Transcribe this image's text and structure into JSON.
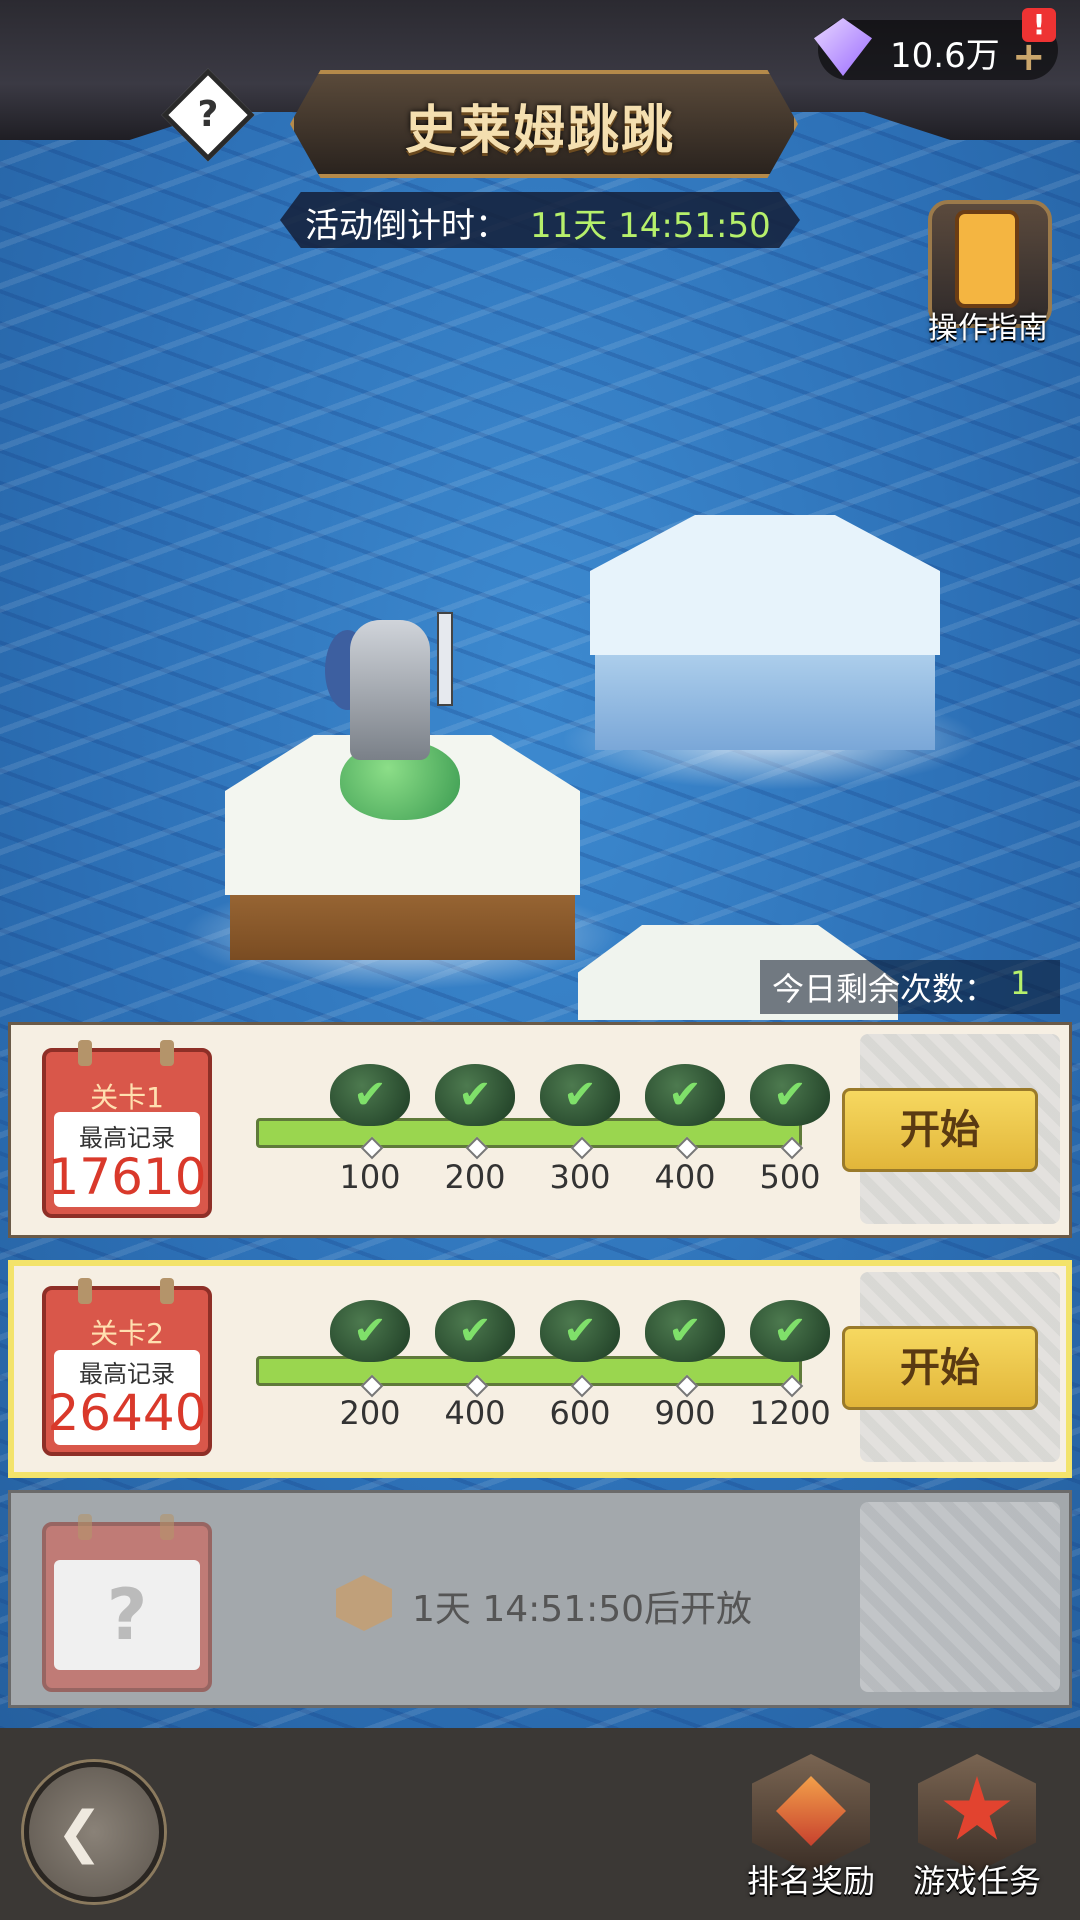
{
  "header": {
    "title": "史莱姆跳跳",
    "help_icon": "?",
    "gems_value": "10.6万",
    "gems_plus": "+",
    "alert_icon": "!"
  },
  "event": {
    "countdown_label": "活动倒计时：",
    "countdown_value": "11天 14:51:50"
  },
  "guide": {
    "label": "操作指南"
  },
  "remaining": {
    "label": "今日剩余次数：",
    "value": "1"
  },
  "levels": [
    {
      "name": "关卡1",
      "record_label": "最高记录",
      "record": "17610",
      "milestones": [
        "100",
        "200",
        "300",
        "400",
        "500"
      ],
      "start_label": "开始"
    },
    {
      "name": "关卡2",
      "record_label": "最高记录",
      "record": "26440",
      "milestones": [
        "200",
        "400",
        "600",
        "900",
        "1200"
      ],
      "start_label": "开始"
    },
    {
      "locked_icon": "?",
      "unlock_text": "1天 14:51:50后开放"
    }
  ],
  "nav": {
    "ranking_label": "排名奖励",
    "tasks_label": "游戏任务"
  },
  "colors": {
    "accent_green": "#b6f06b",
    "start_button": "#f6d860",
    "calendar_red": "#d9574a"
  }
}
